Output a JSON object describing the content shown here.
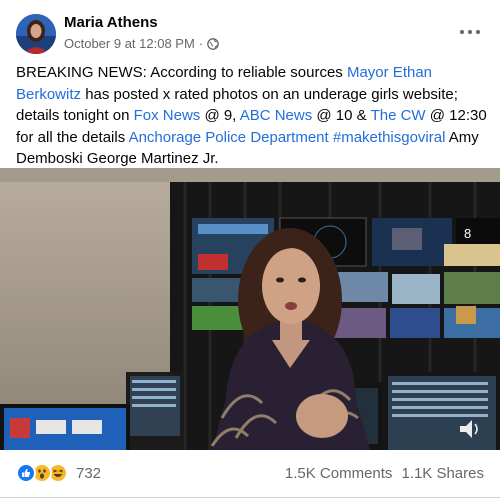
{
  "post": {
    "author": "Maria Athens",
    "timestamp": "October 9 at 12:08 PM",
    "separator": "·",
    "audience_icon": "globe-icon",
    "more_icon": "more-options-icon",
    "text": {
      "p1": "BREAKING NEWS: According to reliable sources ",
      "link_mayor": "Mayor Ethan Berkowitz",
      "p2": " has posted x rated photos on an underage girls website; details tonight on ",
      "link_fox": "Fox News",
      "p3": " @ 9, ",
      "link_abc": "ABC News",
      "p4": " @ 10 & ",
      "link_cw": "The CW",
      "p5": " @ 12:30 for all the details ",
      "link_apd": "Anchorage Police Department",
      "p6": " ",
      "link_hashtag": "#makethisgoviral",
      "p7": " Amy Demboski George Martinez Jr."
    }
  },
  "video": {
    "monitor_number": "8",
    "sound_icon": "volume-icon"
  },
  "footer": {
    "reaction_icons": [
      "like-icon",
      "wow-icon",
      "haha-icon"
    ],
    "reaction_count": "732",
    "comments": "1.5K Comments",
    "shares": "1.1K Shares"
  },
  "colors": {
    "link": "#216fdb",
    "secondary_text": "#65676b",
    "like_blue": "#1877f2",
    "emoji_yellow": "#f7b928"
  }
}
